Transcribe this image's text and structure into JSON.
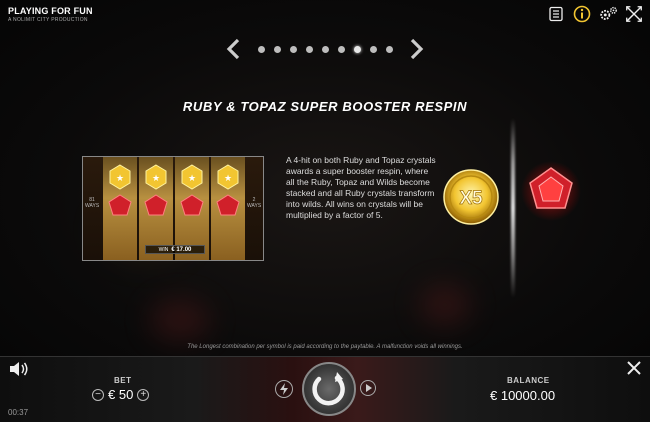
{
  "brand": {
    "title": "PLAYING FOR FUN",
    "subtitle": "A NOLIMIT CITY PRODUCTION"
  },
  "top_icons": [
    "paytable-icon",
    "info-icon",
    "settings-icon",
    "fullscreen-icon"
  ],
  "pager": {
    "total_pages": 9,
    "active_page": 7
  },
  "heading": "RUBY & TOPAZ SUPER BOOSTER RESPIN",
  "preview": {
    "left_side": "81 WAYS",
    "right_side": "2 WAYS",
    "win_label": "WIN",
    "win_value": "€ 17.00"
  },
  "description": "A 4-hit on both Ruby and Topaz crystals awards a super booster respin, where all the Ruby, Topaz and Wilds become stacked and all Ruby crystals transform into wilds. All wins on crystals will be multiplied by a factor of 5.",
  "multiplier_badge": "X5",
  "disclaimer": "The Longest combination per symbol is paid according to the paytable. A malfunction voids all winnings.",
  "bottom_bar": {
    "bet_label": "BET",
    "bet_value": "€ 50",
    "balance_label": "BALANCE",
    "balance_value": "€ 10000.00",
    "clock": "00:37"
  },
  "colors": {
    "accent_gold": "#f2c531",
    "ruby": "#d0202a",
    "background": "#0b0a0a"
  }
}
